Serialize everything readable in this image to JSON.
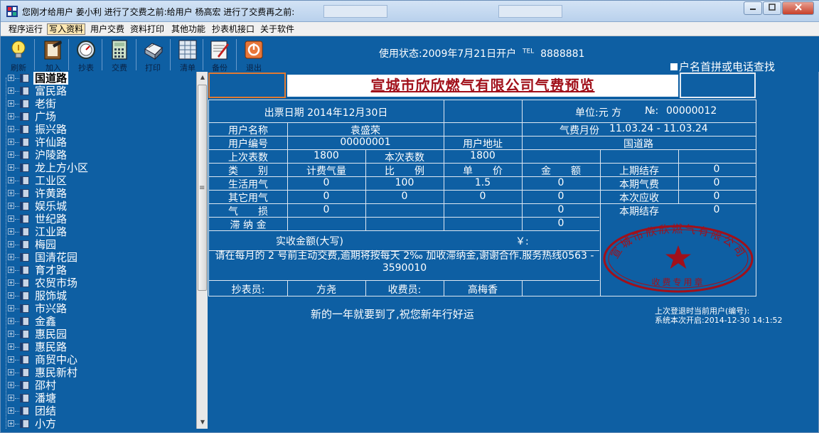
{
  "window": {
    "title": "您刚才给用户 姜小利 进行了交费之前:给用户 杨高宏 进行了交费再之前:",
    "min": "0",
    "max": "1",
    "close": "r"
  },
  "menu": [
    "程序运行",
    "写入资料",
    "用户交费",
    "资料打印",
    "其他功能",
    "抄表机接口",
    "关于软件"
  ],
  "toolbar": {
    "buttons": [
      {
        "label": "刷新",
        "icon": "lightbulb-icon"
      },
      {
        "label": "加入",
        "icon": "add-record-icon"
      },
      {
        "label": "抄表",
        "icon": "meter-icon"
      },
      {
        "label": "交费",
        "icon": "calculator-icon"
      },
      {
        "label": "打印",
        "icon": "printer-icon"
      },
      {
        "label": "清单",
        "icon": "list-icon"
      },
      {
        "label": "备份",
        "icon": "backup-icon"
      },
      {
        "label": "退出",
        "icon": "exit-icon"
      }
    ],
    "status": "使用状态:2009年7月21日开户",
    "tel_label": "TEL",
    "tel": "8888881",
    "search_option": "户名首拼或电话查找"
  },
  "tree": {
    "selected": "国道路",
    "items": [
      "国道路",
      "富民路",
      "老街",
      "广场",
      "振兴路",
      "许仙路",
      "沪陵路",
      "龙上方小区",
      "工业区",
      "许黄路",
      "娱乐城",
      "世纪路",
      "江业路",
      "梅园",
      "国清花园",
      "育才路",
      "农贸市场",
      "服饰城",
      "市兴路",
      "金鑫",
      "惠民园",
      "惠民路",
      "商贸中心",
      "惠民新村",
      "邵村",
      "潘塘",
      "团结",
      "小方"
    ]
  },
  "bill": {
    "title": "宣城市欣欣燃气有限公司气费预览",
    "issue_date": "出票日期 2014年12月30日",
    "unit": "单位:元 方",
    "no_label": "№:",
    "no": "00000012",
    "user_name_label": "用户名称",
    "user_name": "袁盛荣",
    "period_label": "气费月份",
    "period": "11.03.24 - 11.03.24",
    "user_id_label": "用户编号",
    "user_id": "00000001",
    "address_label": "用户地址",
    "address": "国道路",
    "last_reading_label": "上次表数",
    "last_reading": "1800",
    "this_reading_label": "本次表数",
    "this_reading": "1800",
    "headers": [
      "类　　别",
      "计费气量",
      "比　　例",
      "单　　价",
      "金　　额"
    ],
    "rows": [
      {
        "cat": "生活用气",
        "qty": "0",
        "ratio": "100",
        "price": "1.5",
        "amount": "0"
      },
      {
        "cat": "其它用气",
        "qty": "0",
        "ratio": "0",
        "price": "0",
        "amount": "0"
      },
      {
        "cat": "气　　损",
        "qty": "0",
        "ratio": "",
        "price": "",
        "amount": "0"
      },
      {
        "cat": "滞 纳 金",
        "qty": "",
        "ratio": "",
        "price": "",
        "amount": "0"
      }
    ],
    "summary": [
      {
        "label": "上期结存",
        "value": "0"
      },
      {
        "label": "本期气费",
        "value": "0"
      },
      {
        "label": "本次应收",
        "value": "0"
      },
      {
        "label": "本期结存",
        "value": "0"
      }
    ],
    "received_label": "实收金额(大写)",
    "yen": "￥:",
    "note": "请在每月的 2 号前主动交费,逾期将按每天 2‰ 加收滞纳金,谢谢合作.服务热线0563 - 3590010",
    "reader_label": "抄表员:",
    "reader": "方尧",
    "collector_label": "收费员:",
    "collector": "高梅香",
    "stamp_text": "宣城市欣欣燃气有限公司",
    "stamp_sub": "收费专用章",
    "stamp_color": "#a1101a"
  },
  "footer": {
    "message": "新的一年就要到了,祝您新年行好运",
    "login_line1": "上次登退时当前用户(编号):",
    "login_line2": "系统本次开启:2014-12-30 14:1:52"
  }
}
